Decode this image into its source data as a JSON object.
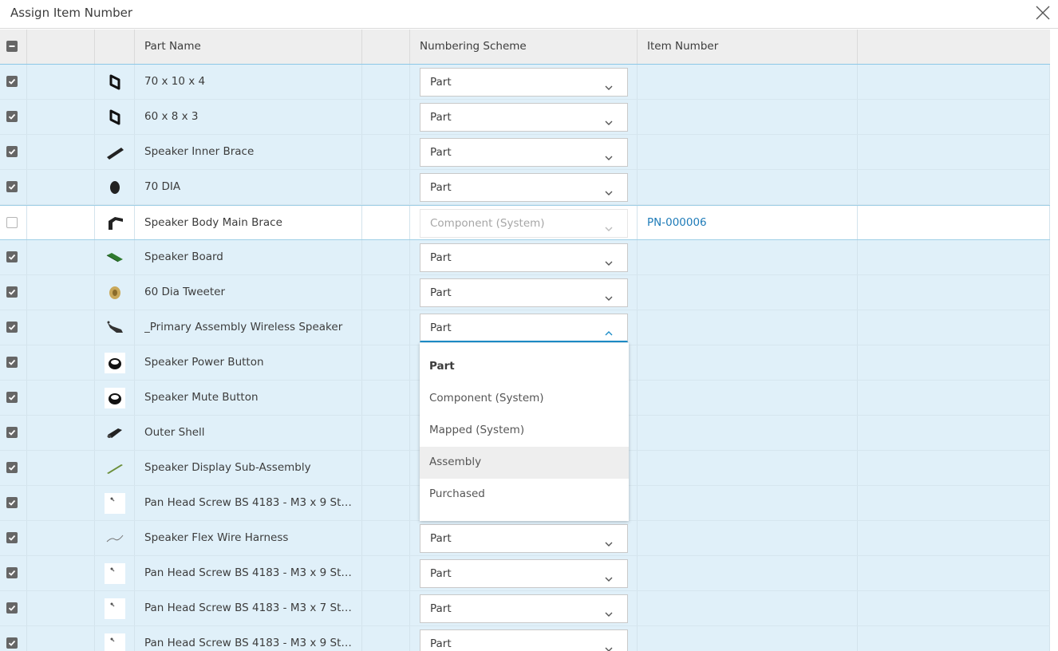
{
  "dialog": {
    "title": "Assign Item Number"
  },
  "columns": [
    "",
    "",
    "",
    "Part Name",
    "",
    "Numbering Scheme",
    "Item Number",
    ""
  ],
  "rows": [
    {
      "name": "70 x 10 x 4",
      "scheme": "Part",
      "item": "",
      "checked": true,
      "icon": "frame-part-icon"
    },
    {
      "name": "60 x 8 x 3",
      "scheme": "Part",
      "item": "",
      "checked": true,
      "icon": "frame-part-icon"
    },
    {
      "name": "Speaker Inner Brace",
      "scheme": "Part",
      "item": "",
      "checked": true,
      "icon": "brace-part-icon"
    },
    {
      "name": "70 DIA",
      "scheme": "Part",
      "item": "",
      "checked": true,
      "icon": "disc-part-icon"
    },
    {
      "name": "Speaker Body Main Brace",
      "scheme": "Component (System)",
      "item": "PN-000006",
      "checked": false,
      "icon": "bracket-part-icon"
    },
    {
      "name": "Speaker Board",
      "scheme": "Part",
      "item": "",
      "checked": true,
      "icon": "circuit-board-icon"
    },
    {
      "name": "60 Dia Tweeter",
      "scheme": "Part",
      "item": "",
      "checked": true,
      "icon": "tweeter-part-icon"
    },
    {
      "name": "_Primary Assembly Wireless Speaker",
      "scheme": "Part",
      "item": "",
      "checked": true,
      "icon": "assembly-icon"
    },
    {
      "name": "Speaker Power Button",
      "scheme": "",
      "item": "",
      "checked": true,
      "icon": "button-part-icon"
    },
    {
      "name": "Speaker Mute Button",
      "scheme": "",
      "item": "",
      "checked": true,
      "icon": "button-part-icon"
    },
    {
      "name": "Outer Shell",
      "scheme": "",
      "item": "",
      "checked": true,
      "icon": "shell-part-icon"
    },
    {
      "name": "Speaker Display Sub-Assembly",
      "scheme": "",
      "item": "",
      "checked": true,
      "icon": "display-part-icon"
    },
    {
      "name": "Pan Head Screw BS 4183 - M3 x 9 Stee…",
      "scheme": "",
      "item": "",
      "checked": true,
      "icon": "screw-part-icon"
    },
    {
      "name": "Speaker Flex Wire Harness",
      "scheme": "Part",
      "item": "",
      "checked": true,
      "icon": "wire-harness-icon"
    },
    {
      "name": "Pan Head Screw BS 4183 - M3 x 9 Stee…",
      "scheme": "Part",
      "item": "",
      "checked": true,
      "icon": "screw-part-icon"
    },
    {
      "name": "Pan Head Screw BS 4183 - M3 x 7 Stee…",
      "scheme": "Part",
      "item": "",
      "checked": true,
      "icon": "screw-part-icon"
    },
    {
      "name": "Pan Head Screw BS 4183 - M3 x 9 Stee…",
      "scheme": "Part",
      "item": "",
      "checked": true,
      "icon": "screw-part-icon"
    }
  ],
  "dropdown": {
    "options": [
      "Part",
      "Component (System)",
      "Mapped (System)",
      "Assembly",
      "Purchased"
    ],
    "selected": "Part",
    "hovered": "Assembly"
  },
  "colors": {
    "row_selected": "#e0f0f9",
    "link": "#1e7bb8",
    "focus": "#1e8dc8"
  }
}
